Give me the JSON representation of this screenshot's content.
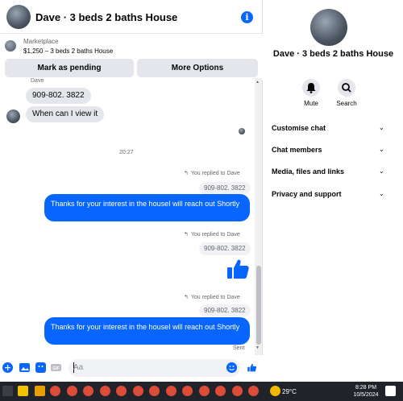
{
  "header": {
    "title": "Dave · 3 beds 2 baths House",
    "info_icon": "info-icon"
  },
  "marketplace": {
    "label": "Marketplace",
    "listing": "$1,250 – 3 beds 2 baths House",
    "mark_pending_label": "Mark as pending",
    "more_options_label": "More Options"
  },
  "messages": {
    "sender_name": "Dave",
    "incoming": [
      "909-802. 3822",
      "When can I view it"
    ],
    "timestamp": "20:27",
    "replies": [
      {
        "note": "You replied to Dave",
        "quoted": "909-802. 3822",
        "text": "Thanks for your interest in the houseI will reach out Shortly"
      },
      {
        "note": "You replied to Dave",
        "quoted": "909-802. 3822",
        "text": "👍"
      },
      {
        "note": "You replied to Dave",
        "quoted": "909-802. 3822",
        "text": "Thanks for your interest in the houseI will reach out Shortly"
      }
    ],
    "status": "Sent"
  },
  "composer": {
    "placeholder": "Aa"
  },
  "panel": {
    "name": "Dave · 3 beds 2 baths House",
    "actions": [
      {
        "label": "Mute",
        "icon": "bell-icon"
      },
      {
        "label": "Search",
        "icon": "search-icon"
      }
    ],
    "sections": [
      "Customise chat",
      "Chat members",
      "Media, files and links",
      "Privacy and support"
    ]
  },
  "taskbar": {
    "weather": "29°C",
    "time": "8:28 PM",
    "date": "10/5/2024"
  },
  "colors": {
    "accent": "#0866ff",
    "bubble_in": "#e4e6eb",
    "taskbar": "#20242a"
  }
}
